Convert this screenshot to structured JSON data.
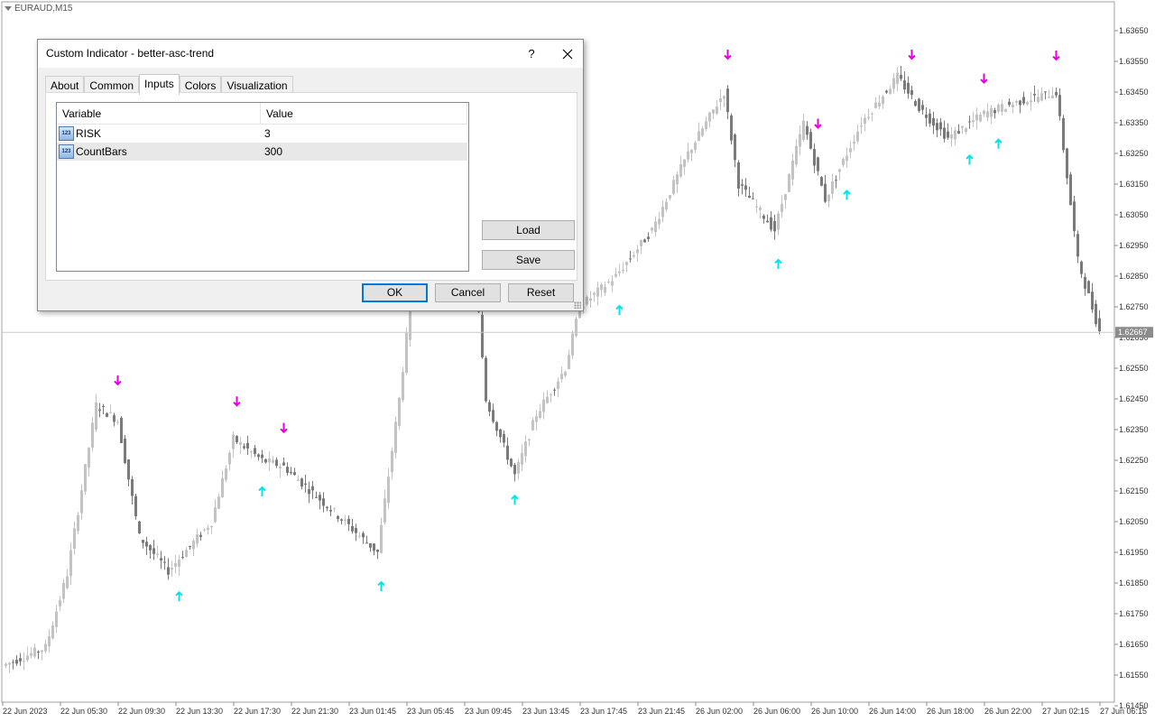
{
  "chart": {
    "symbol_label": "EURAUD,M15",
    "colors": {
      "background": "#ffffff",
      "bull": "#c3c3c3",
      "bear": "#7a7a7a",
      "up_arrow": "#00e5ee",
      "down_arrow": "#e600e6",
      "price_line": "#c0c0c0",
      "current_price_bg": "#8c8c8c"
    },
    "current_price": "1.62667",
    "price_axis": [
      "1.63650",
      "1.63550",
      "1.63450",
      "1.63350",
      "1.63250",
      "1.63150",
      "1.63050",
      "1.62950",
      "1.62850",
      "1.62750",
      "1.62650",
      "1.62550",
      "1.62450",
      "1.62350",
      "1.62250",
      "1.62150",
      "1.62050",
      "1.61950",
      "1.61850",
      "1.61750",
      "1.61650",
      "1.61550",
      "1.61450"
    ],
    "time_axis": [
      "22 Jun 2023",
      "22 Jun 05:30",
      "22 Jun 09:30",
      "22 Jun 13:30",
      "22 Jun 17:30",
      "22 Jun 21:30",
      "23 Jun 01:45",
      "23 Jun 05:45",
      "23 Jun 09:45",
      "23 Jun 13:45",
      "23 Jun 17:45",
      "23 Jun 21:45",
      "26 Jun 02:00",
      "26 Jun 06:00",
      "26 Jun 10:00",
      "26 Jun 14:00",
      "26 Jun 18:00",
      "26 Jun 22:00",
      "27 Jun 02:15",
      "27 Jun 06:15"
    ],
    "signals": [
      {
        "type": "down",
        "bar": 31
      },
      {
        "type": "down",
        "bar": 64
      },
      {
        "type": "down",
        "bar": 77
      },
      {
        "type": "up",
        "bar": 48
      },
      {
        "type": "up",
        "bar": 71
      },
      {
        "type": "up",
        "bar": 104
      },
      {
        "type": "up",
        "bar": 141
      },
      {
        "type": "up",
        "bar": 170
      },
      {
        "type": "down",
        "bar": 200
      },
      {
        "type": "up",
        "bar": 214
      },
      {
        "type": "down",
        "bar": 225
      },
      {
        "type": "up",
        "bar": 233
      },
      {
        "type": "down",
        "bar": 251
      },
      {
        "type": "up",
        "bar": 267
      },
      {
        "type": "down",
        "bar": 271
      },
      {
        "type": "up",
        "bar": 275
      },
      {
        "type": "down",
        "bar": 291
      }
    ]
  },
  "dialog": {
    "title": "Custom Indicator - better-asc-trend",
    "help_label": "?",
    "tabs": [
      "About",
      "Common",
      "Inputs",
      "Colors",
      "Visualization"
    ],
    "active_tab": "Inputs",
    "grid": {
      "headers": [
        "Variable",
        "Value"
      ],
      "rows": [
        {
          "icon": "123",
          "name": "RISK",
          "value": "3"
        },
        {
          "icon": "123",
          "name": "CountBars",
          "value": "300"
        }
      ]
    },
    "buttons": {
      "load": "Load",
      "save": "Save",
      "ok": "OK",
      "cancel": "Cancel",
      "reset": "Reset"
    }
  }
}
